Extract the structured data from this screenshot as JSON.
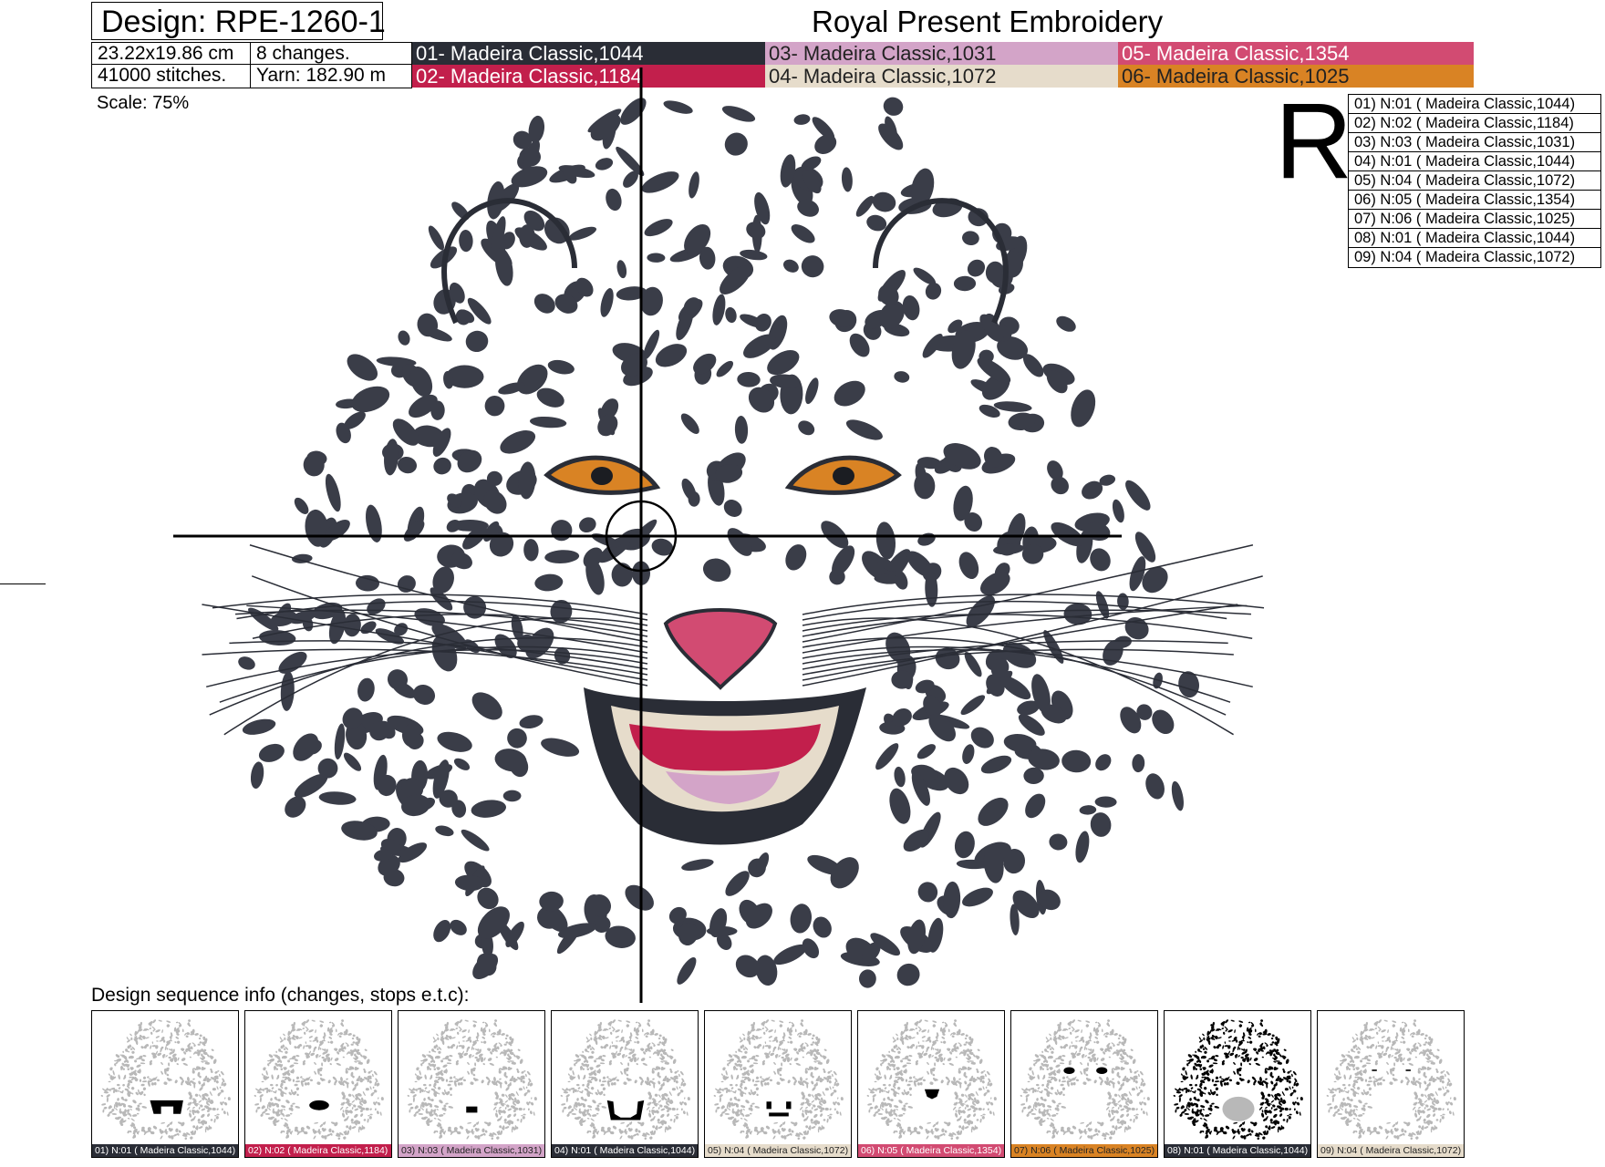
{
  "header": {
    "design_title": "Design: RPE-1260-1",
    "brand": "Royal Present Embroidery",
    "size": "23.22x19.86 cm",
    "changes": "8 changes.",
    "stitches": "41000 stitches.",
    "yarn": "Yarn: 182.90 m",
    "scale": "Scale: 75%"
  },
  "colors": [
    {
      "label": "01- Madeira Classic,1044",
      "color": "#2a2d36",
      "text": "#ffffff"
    },
    {
      "label": "02- Madeira Classic,1184",
      "color": "#c21f4c",
      "text": "#ffffff"
    },
    {
      "label": "03- Madeira Classic,1031",
      "color": "#d3a4c8",
      "text": "#222222"
    },
    {
      "label": "04- Madeira Classic,1072",
      "color": "#e6dccb",
      "text": "#222222"
    },
    {
      "label": "05- Madeira Classic,1354",
      "color": "#d24b72",
      "text": "#ffffff"
    },
    {
      "label": "06- Madeira Classic,1025",
      "color": "#d98324",
      "text": "#222222"
    }
  ],
  "r_letter": "R",
  "stops": [
    "01) N:01 ( Madeira Classic,1044)",
    "02) N:02 ( Madeira Classic,1184)",
    "03) N:03 ( Madeira Classic,1031)",
    "04) N:01 ( Madeira Classic,1044)",
    "05) N:04 ( Madeira Classic,1072)",
    "06) N:05 ( Madeira Classic,1354)",
    "07) N:06 ( Madeira Classic,1025)",
    "08) N:01 ( Madeira Classic,1044)",
    "09) N:04 ( Madeira Classic,1072)"
  ],
  "sequence": {
    "label": "Design sequence info (changes, stops e.t.c):",
    "thumbs": [
      {
        "caption": "01) N:01 ( Madeira Classic,1044)",
        "color": "#2a2d36",
        "text": "#ffffff",
        "highlight": "mouth-outline"
      },
      {
        "caption": "02) N:02 ( Madeira Classic,1184)",
        "color": "#c21f4c",
        "text": "#ffffff",
        "highlight": "tongue"
      },
      {
        "caption": "03) N:03 ( Madeira Classic,1031)",
        "color": "#d3a4c8",
        "text": "#222222",
        "highlight": "lower-tongue"
      },
      {
        "caption": "04) N:01 ( Madeira Classic,1044)",
        "color": "#2a2d36",
        "text": "#ffffff",
        "highlight": "mouth-frame"
      },
      {
        "caption": "05) N:04 ( Madeira Classic,1072)",
        "color": "#e6dccb",
        "text": "#222222",
        "highlight": "teeth"
      },
      {
        "caption": "06) N:05 ( Madeira Classic,1354)",
        "color": "#d24b72",
        "text": "#ffffff",
        "highlight": "nose"
      },
      {
        "caption": "07) N:06 ( Madeira Classic,1025)",
        "color": "#d98324",
        "text": "#222222",
        "highlight": "eyes"
      },
      {
        "caption": "08) N:01 ( Madeira Classic,1044)",
        "color": "#2a2d36",
        "text": "#ffffff",
        "highlight": "all-spots"
      },
      {
        "caption": "09) N:04 ( Madeira Classic,1072)",
        "color": "#e6dccb",
        "text": "#222222",
        "highlight": "eye-highlights"
      }
    ]
  }
}
